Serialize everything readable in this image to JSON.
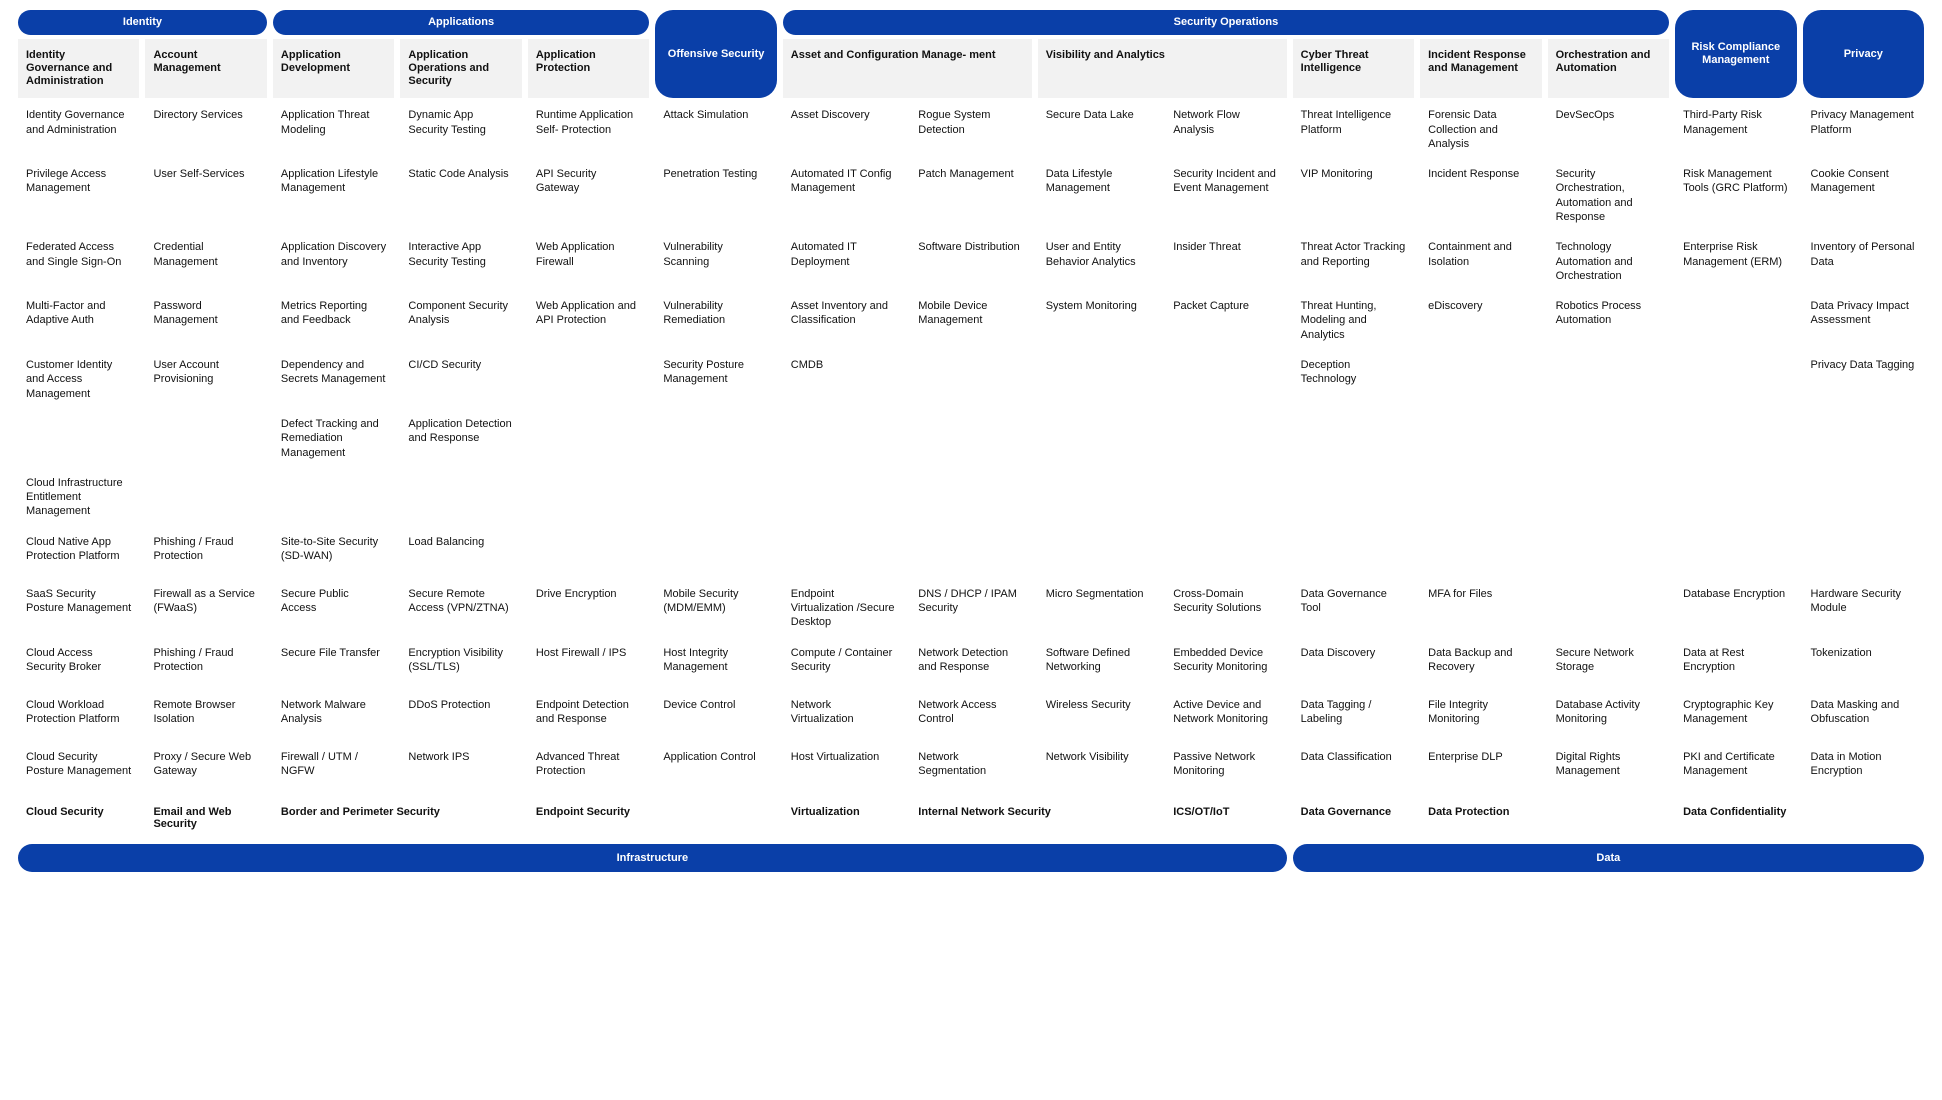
{
  "topPills": {
    "identity": "Identity",
    "applications": "Applications",
    "offsec": "Offensive Security",
    "secops": "Security Operations",
    "riskcomp": "Risk Compliance Management",
    "privacy": "Privacy"
  },
  "subHeaders": {
    "iga": "Identity Governance and Administration",
    "acct": "Account Management",
    "appdev": "Application Development",
    "appops": "Application Operations and Security",
    "appprot": "Application Protection",
    "acm": "Asset and Configuration Manage- ment",
    "va": "Visibility and Analytics",
    "cti": "Cyber Threat Intelligence",
    "irm": "Incident Response and Management",
    "oa": "Orchestration and Automation"
  },
  "cols": {
    "c1": [
      "Identity Governance and Administration",
      "Privilege Access Management",
      "Federated Access and Single Sign-On",
      "Multi-Factor and Adaptive Auth",
      "Customer Identity and Access Management",
      "Cloud Infrastructure Entitlement Management"
    ],
    "c2": [
      "Directory Services",
      "User Self-Services",
      "Credential Management",
      "Password Management",
      "User Account Provisioning"
    ],
    "c3": [
      "Application Threat Modeling",
      "Application Lifestyle Management",
      "Application Discovery and Inventory",
      "Metrics Reporting and Feedback",
      "Dependency and Secrets Management",
      "Defect Tracking and Remediation Management"
    ],
    "c4": [
      "Dynamic App Security Testing",
      "Static Code Analysis",
      "Interactive App Security Testing",
      "Component Security Analysis",
      "CI/CD Security",
      "Application Detection and Response"
    ],
    "c5": [
      "Runtime Application Self- Protection",
      "API Security Gateway",
      "Web Application Firewall",
      "Web Application and API Protection"
    ],
    "c6": [
      "Attack Simulation",
      "Penetration Testing",
      "Vulnerability Scanning",
      "Vulnerability Remediation",
      "Security Posture Management"
    ],
    "c7": [
      "Asset Discovery",
      "Automated IT Config Management",
      "Automated IT Deployment",
      "Asset Inventory and Classification",
      "CMDB"
    ],
    "c8": [
      "Rogue System Detection",
      "Patch Management",
      "Software Distribution",
      "Mobile Device Management"
    ],
    "c9": [
      "Secure Data Lake",
      "Data Lifestyle Management",
      "User and Entity Behavior Analytics",
      "System Monitoring"
    ],
    "c10": [
      "Network Flow Analysis",
      "Security Incident and Event Management",
      "Insider Threat",
      "Packet Capture"
    ],
    "c11": [
      "Threat Intelligence Platform",
      "VIP Monitoring",
      "Threat Actor Tracking and Reporting",
      "Threat Hunting, Modeling and Analytics",
      "Deception Technology"
    ],
    "c12": [
      "Forensic Data Collection and Analysis",
      "Incident Response",
      "Containment and Isolation",
      "eDiscovery"
    ],
    "c13": [
      "DevSecOps",
      "Security Orchestration, Automation and Response",
      "Technology Automation and Orchestration",
      "Robotics Process Automation"
    ],
    "c14": [
      "Third-Party Risk Management",
      "Risk Management Tools (GRC Platform)",
      "Enterprise Risk Management (ERM)"
    ],
    "c15": [
      "Privacy Management Platform",
      "Cookie Consent Management",
      "Inventory of Personal Data",
      "Data Privacy Impact Assessment",
      "Privacy Data Tagging"
    ]
  },
  "midRow1": {
    "c1": "Cloud Native App Protection Platform",
    "c2": "Phishing / Fraud Protection",
    "c3": "Site-to-Site Security (SD-WAN)",
    "c4": "Load Balancing"
  },
  "lower": {
    "c1": [
      "SaaS Security Posture Management",
      "Cloud Access Security Broker",
      "Cloud Workload Protection Platform",
      "Cloud Security Posture Management"
    ],
    "c2": [
      "Firewall as a Service (FWaaS)",
      "Phishing / Fraud Protection",
      "Remote Browser Isolation",
      "Proxy / Secure Web Gateway"
    ],
    "c3": [
      "Secure Public Access",
      "Secure File Transfer",
      "Network Malware Analysis",
      "Firewall / UTM / NGFW"
    ],
    "c4": [
      "Secure Remote Access (VPN/ZTNA)",
      "Encryption Visibility (SSL/TLS)",
      "DDoS Protection",
      "Network IPS"
    ],
    "c5": [
      "Drive Encryption",
      "Host Firewall / IPS",
      "Endpoint Detection and Response",
      "Advanced Threat Protection"
    ],
    "c6": [
      "Mobile Security (MDM/EMM)",
      "Host Integrity Management",
      "Device Control",
      "Application Control"
    ],
    "c7": [
      "Endpoint Virtualization /Secure Desktop",
      "Compute / Container Security",
      "Network Virtualization",
      "Host Virtualization"
    ],
    "c8": [
      "DNS / DHCP / IPAM Security",
      "Network Detection and Response",
      "Network Access Control",
      "Network Segmentation"
    ],
    "c9": [
      "Micro Segmentation",
      "Software Defined Networking",
      "Wireless Security",
      "Network Visibility"
    ],
    "c10": [
      "Cross-Domain Security Solutions",
      "Embedded Device Security Monitoring",
      "Active Device and Network Monitoring",
      "Passive Network Monitoring"
    ],
    "c11": [
      "Data Governance Tool",
      "Data Discovery",
      "Data Tagging / Labeling",
      "Data Classification"
    ],
    "c12": [
      "MFA for Files",
      "Data Backup and Recovery",
      "File Integrity Monitoring",
      "Enterprise DLP"
    ],
    "c13": [
      "",
      "Secure Network Storage",
      "Database Activity Monitoring",
      "Digital Rights Management"
    ],
    "c14": [
      "Database Encryption",
      "Data at Rest Encryption",
      "Cryptographic Key Management",
      "PKI and Certificate Management"
    ],
    "c15": [
      "Hardware Security Module",
      "Tokenization",
      "Data Masking and Obfuscation",
      "Data in Motion Encryption"
    ]
  },
  "bottomSub": {
    "cloudsec": "Cloud Security",
    "emailweb": "Email and Web Security",
    "border": "Border and Perimeter Security",
    "endpoint": "Endpoint Security",
    "virt": "Virtualization",
    "intnet": "Internal Network Security",
    "icsot": "ICS/OT/IoT",
    "datagov": "Data Governance",
    "dataprot": "Data Protection",
    "dataconf": "Data Confidentiality"
  },
  "bottomPills": {
    "infra": "Infrastructure",
    "data": "Data"
  }
}
